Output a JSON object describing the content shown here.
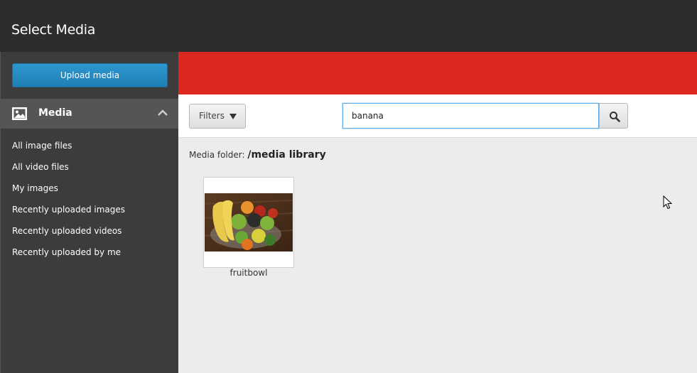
{
  "window": {
    "title": "Select Media"
  },
  "sidebar": {
    "upload_label": "Upload media",
    "section": {
      "label": "Media",
      "icon": "image-icon",
      "toggle_icon": "chevron-up-icon"
    },
    "items": [
      {
        "label": "All image files"
      },
      {
        "label": "All video files"
      },
      {
        "label": "My images"
      },
      {
        "label": "Recently uploaded images"
      },
      {
        "label": "Recently uploaded videos"
      },
      {
        "label": "Recently uploaded by me"
      }
    ]
  },
  "toolbar": {
    "filters_label": "Filters",
    "search": {
      "value": "banana",
      "placeholder": ""
    }
  },
  "content": {
    "folder_prefix": "Media folder:",
    "folder_path": "/media library",
    "items": [
      {
        "name": "fruitbowl"
      }
    ]
  },
  "colors": {
    "accent_red": "#dc281e",
    "button_blue": "#2e97cf",
    "titlebar": "#2d2d2d",
    "sidebar": "#3c3c3c"
  }
}
